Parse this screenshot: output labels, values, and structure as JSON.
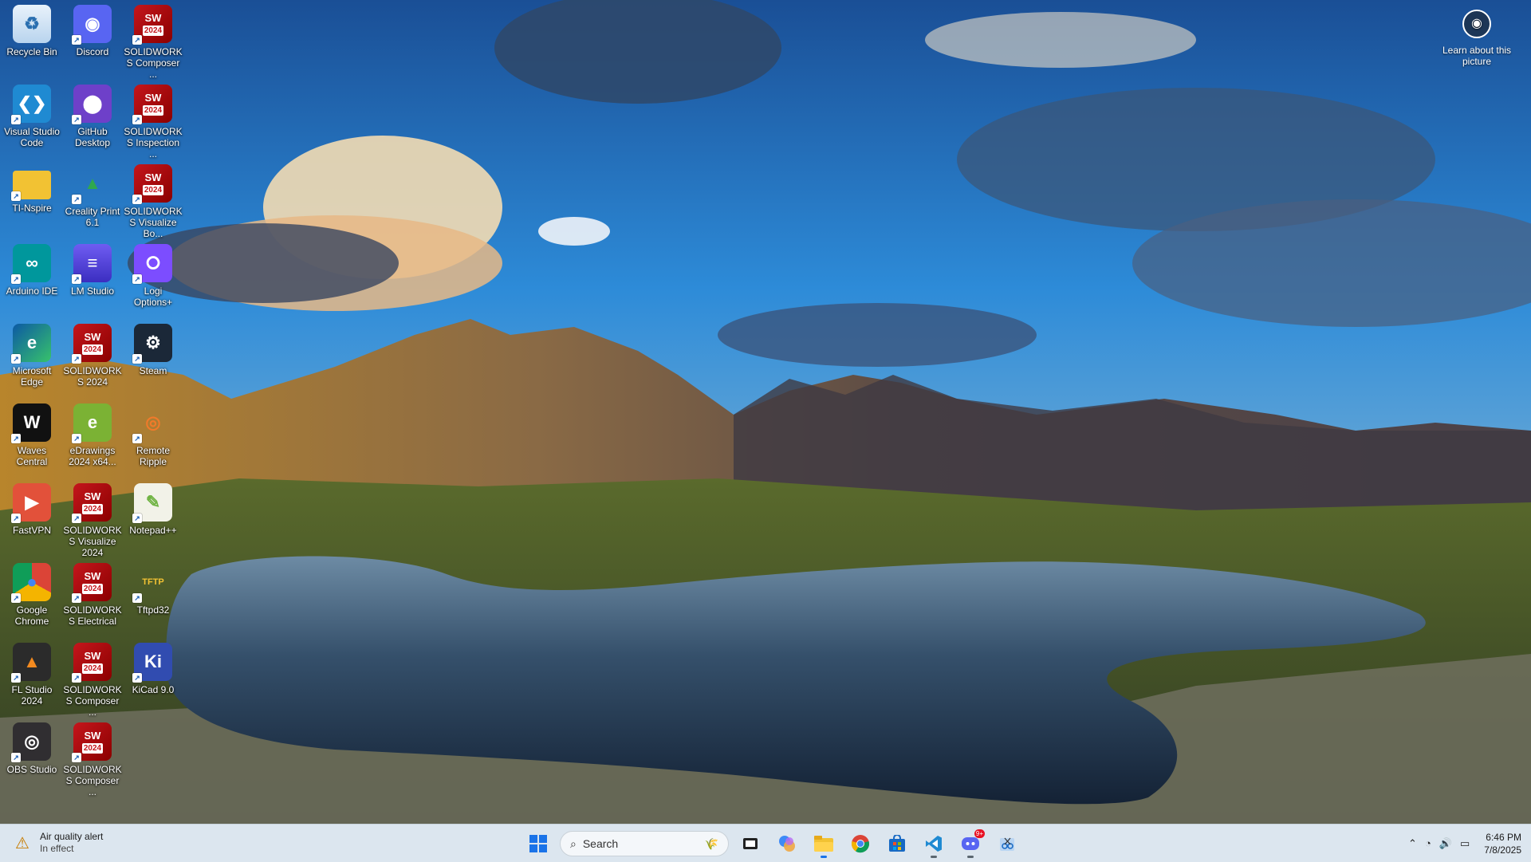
{
  "desktop": {
    "icons": [
      {
        "label": "Recycle Bin",
        "icon": "recycle-bin-icon"
      },
      {
        "label": "Discord",
        "icon": "discord-icon"
      },
      {
        "label": "SOLIDWORKS Composer ...",
        "icon": "solidworks-composer-icon"
      },
      {
        "label": "Visual Studio Code",
        "icon": "vscode-icon"
      },
      {
        "label": "GitHub Desktop",
        "icon": "github-desktop-icon"
      },
      {
        "label": "SOLIDWORKS Inspection ...",
        "icon": "solidworks-inspection-icon"
      },
      {
        "label": "TI-Nspire",
        "icon": "folder-icon"
      },
      {
        "label": "Creality Print 6.1",
        "icon": "creality-print-icon"
      },
      {
        "label": "SOLIDWORKS Visualize Bo...",
        "icon": "solidworks-visualize-boost-icon"
      },
      {
        "label": "Arduino IDE",
        "icon": "arduino-icon"
      },
      {
        "label": "LM Studio",
        "icon": "lm-studio-icon"
      },
      {
        "label": "Logi Options+",
        "icon": "logi-options-icon"
      },
      {
        "label": "Microsoft Edge",
        "icon": "edge-icon"
      },
      {
        "label": "SOLIDWORKS 2024",
        "icon": "solidworks-icon"
      },
      {
        "label": "Steam",
        "icon": "steam-icon"
      },
      {
        "label": "Waves Central",
        "icon": "waves-central-icon"
      },
      {
        "label": "eDrawings 2024 x64...",
        "icon": "edrawings-icon"
      },
      {
        "label": "Remote Ripple",
        "icon": "remote-ripple-icon"
      },
      {
        "label": "FastVPN",
        "icon": "fastvpn-icon"
      },
      {
        "label": "SOLIDWORKS Visualize 2024",
        "icon": "solidworks-visualize-icon"
      },
      {
        "label": "Notepad++",
        "icon": "notepad-plus-plus-icon"
      },
      {
        "label": "Google Chrome",
        "icon": "chrome-icon"
      },
      {
        "label": "SOLIDWORKS Electrical",
        "icon": "solidworks-electrical-icon"
      },
      {
        "label": "Tftpd32",
        "icon": "tftpd32-icon"
      },
      {
        "label": "FL Studio 2024",
        "icon": "fl-studio-icon"
      },
      {
        "label": "SOLIDWORKS Composer ...",
        "icon": "solidworks-composer-icon"
      },
      {
        "label": "KiCad 9.0",
        "icon": "kicad-icon"
      },
      {
        "label": "OBS Studio",
        "icon": "obs-studio-icon"
      },
      {
        "label": "SOLIDWORKS Composer ...",
        "icon": "solidworks-composer-icon"
      }
    ],
    "sw_badge": "SW",
    "sw_year": "2024",
    "learn_about": "Learn about this picture"
  },
  "taskbar": {
    "alert_title": "Air quality alert",
    "alert_sub": "In effect",
    "search_placeholder": "Search",
    "apps": [
      "start-icon",
      "search",
      "task-view-icon",
      "copilot-icon",
      "file-explorer-icon",
      "chrome-icon",
      "microsoft-store-icon",
      "vscode-icon",
      "discord-icon",
      "snipping-tool-icon"
    ],
    "discord_badge": "9+",
    "time": "6:46 PM",
    "date": "7/8/2025"
  },
  "colors": {
    "taskbar_bg": "#dce6ef",
    "sky_top": "#1e5fa8",
    "lake": "#1f3550"
  }
}
